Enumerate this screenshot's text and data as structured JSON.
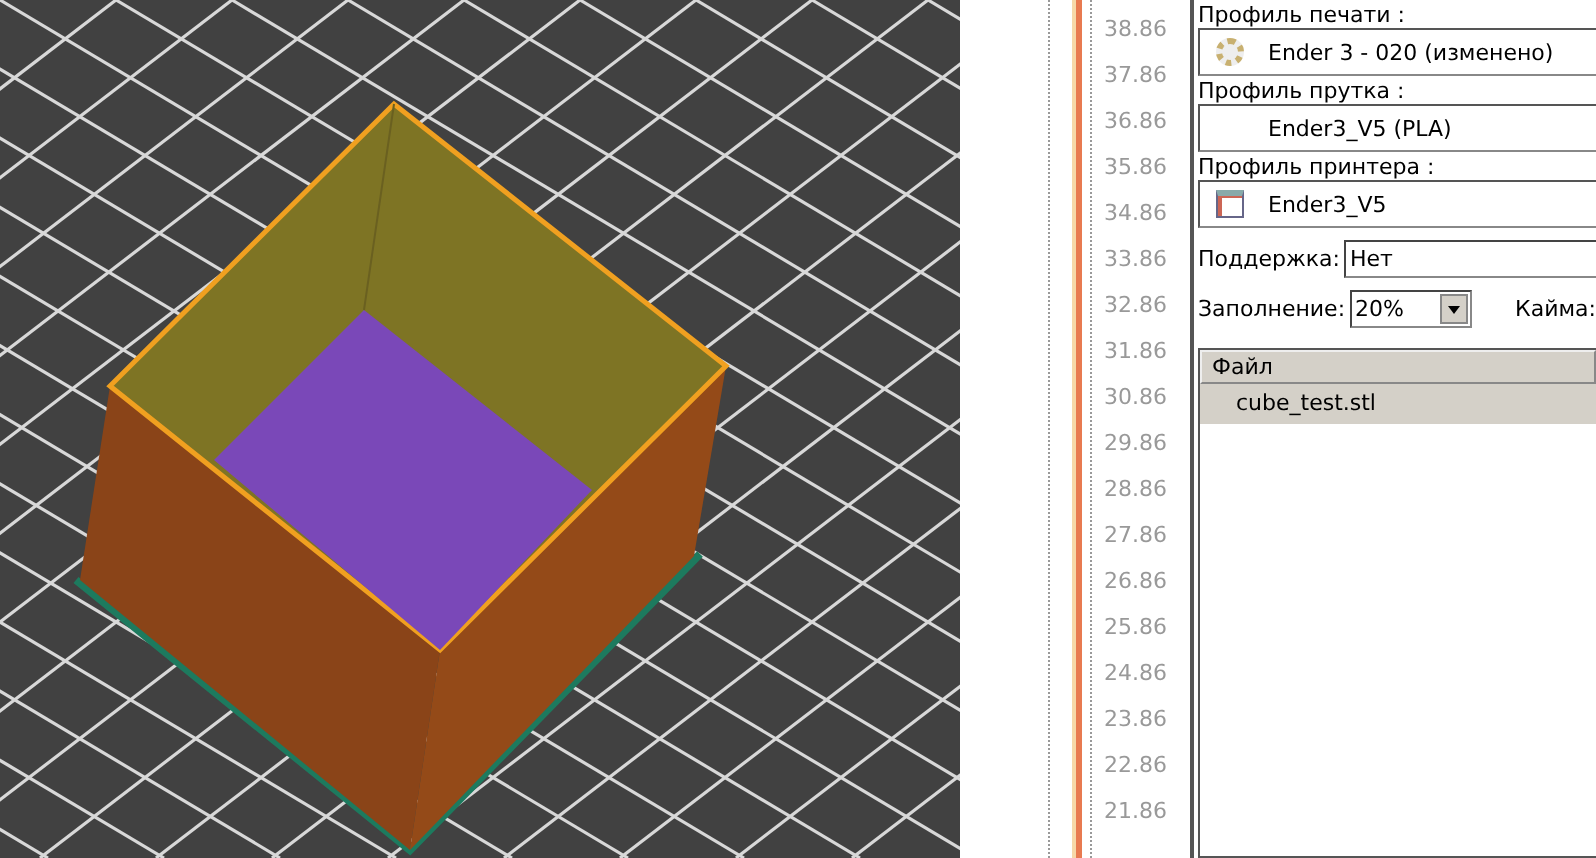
{
  "ruler": {
    "labels": [
      "38.86",
      "37.86",
      "36.86",
      "35.86",
      "34.86",
      "33.86",
      "32.86",
      "31.86",
      "30.86",
      "29.86",
      "28.86",
      "27.86",
      "26.86",
      "25.86",
      "24.86",
      "23.86",
      "22.86",
      "21.86"
    ]
  },
  "profiles": [
    {
      "label": "Профиль печати :",
      "value": "Ender 3 - 020 (изменено)",
      "kind": "gear"
    },
    {
      "label": "Профиль прутка :",
      "value": "Ender3_V5 (PLA)",
      "kind": "plain"
    },
    {
      "label": "Профиль принтера :",
      "value": "Ender3_V5",
      "kind": "printer"
    }
  ],
  "support": {
    "label": "Поддержка:",
    "value": "Нет"
  },
  "infill": {
    "label": "Заполнение:",
    "value": "20%"
  },
  "brim": {
    "label": "Кайма:"
  },
  "files": {
    "columns": [
      "Файл"
    ],
    "rows": [
      {
        "name": "cube_test.stl",
        "selected": true
      }
    ]
  }
}
